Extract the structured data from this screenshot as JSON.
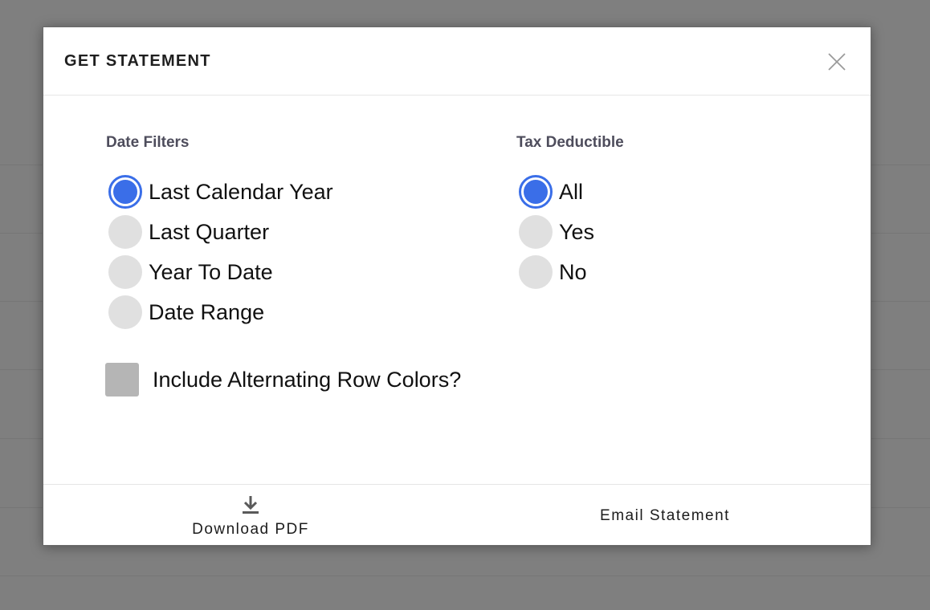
{
  "modal": {
    "title": "GET STATEMENT",
    "close_icon": "close-icon"
  },
  "date_filters": {
    "label": "Date Filters",
    "selected": "Last Calendar Year",
    "options": [
      {
        "label": "Last Calendar Year",
        "checked": true
      },
      {
        "label": "Last Quarter",
        "checked": false
      },
      {
        "label": "Year To Date",
        "checked": false
      },
      {
        "label": "Date Range",
        "checked": false
      }
    ]
  },
  "tax_deductible": {
    "label": "Tax Deductible",
    "selected": "All",
    "options": [
      {
        "label": "All",
        "checked": true
      },
      {
        "label": "Yes",
        "checked": false
      },
      {
        "label": "No",
        "checked": false
      }
    ]
  },
  "alternating_rows": {
    "label": "Include Alternating Row Colors?",
    "checked": false
  },
  "footer": {
    "download_label": "Download PDF",
    "download_icon": "download-icon",
    "email_label": "Email Statement"
  },
  "colors": {
    "accent": "#3a6ee8",
    "backdrop": "#7f7f7f",
    "unchecked": "#e0e0e0",
    "checkbox": "#b5b5b5"
  }
}
